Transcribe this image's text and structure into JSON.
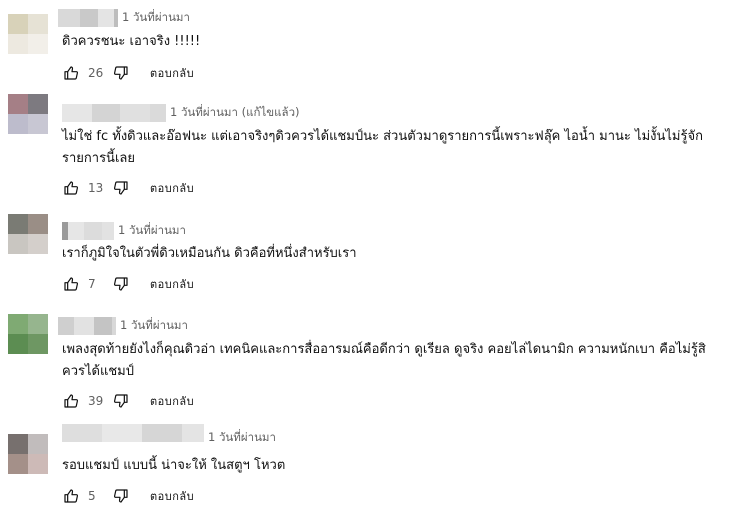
{
  "colors": {
    "text": "#0f0f0f",
    "meta": "#606060",
    "background": "#ffffff"
  },
  "comments": [
    {
      "time": "1 วันที่ผ่านมา",
      "text": "ดิวควรชนะ เอาจริง !!!!!",
      "likes": "26",
      "reply_label": "ตอบกลับ",
      "avatar_colors": [
        "#d8d2b9",
        "#e6e2d5",
        "#ede9e0",
        "#f2efe9"
      ],
      "name_blur_colors": [
        "#d9d9d9",
        "#c9c9c9",
        "#e4e4e4",
        "#bdbdbd"
      ]
    },
    {
      "time": "1 วันที่ผ่านมา (แก้ไขแล้ว)",
      "text": "ไม่ใช่ fc ทั้งดิวและอ๊อฟนะ แต่เอาจริงๆดิวควรได้แชมป์นะ  ส่วนตัวมาดูรายการนี้เพราะฟลุ๊ค ไอน้ำ มานะ ไม่งั้นไม่รู้จักรายการนี้เลย",
      "likes": "13",
      "reply_label": "ตอบกลับ",
      "avatar_colors": [
        "#a57f86",
        "#7d7a80",
        "#bdbccc",
        "#c8c7d3"
      ],
      "name_blur_colors": [
        "#e6e6e6",
        "#d4d4d4",
        "#e0e0e0",
        "#dadada"
      ]
    },
    {
      "time": "1 วันที่ผ่านมา",
      "text": "เราก็ภูมิใจในตัวพี่ดิวเหมือนกัน ดิวคือที่หนึ่งสำหรับเรา",
      "likes": "7",
      "reply_label": "ตอบกลับ",
      "avatar_colors": [
        "#7a7b74",
        "#9a8e86",
        "#c9c6c1",
        "#d4cfcb"
      ],
      "name_blur_colors": [
        "#9a9a9a",
        "#e6e6e6",
        "#dcdcdc",
        "#e2e2e2"
      ]
    },
    {
      "time": "1 วันที่ผ่านมา",
      "text": "เพลงสุดท้ายยังไงก็คุณดิวอ่า เทคนิคและการสื่ออารมณ์คือดีกว่า ดูเรียล ดูจริง คอยไล่ไดนามิก ความหนักเบา คือไม่รู้สิ ควรได้แชมป์",
      "likes": "39",
      "reply_label": "ตอบกลับ",
      "avatar_colors": [
        "#7faa73",
        "#96b58e",
        "#5c8d52",
        "#6e9763"
      ],
      "name_blur_colors": [
        "#cfcfcf",
        "#e2e2e2",
        "#c4c4c4",
        "#d8d8d8"
      ]
    },
    {
      "time": "1 วันที่ผ่านมา",
      "text": "รอบแชมป์ แบบนี้  น่าจะให้ ในสตูฯ โหวต",
      "likes": "5",
      "reply_label": "ตอบกลับ",
      "avatar_colors": [
        "#77706e",
        "#c1bcbc",
        "#a49089",
        "#cdbab7"
      ],
      "name_blur_colors": [
        "#dedede",
        "#e8e8e8",
        "#d6d6d6",
        "#e4e4e4"
      ]
    }
  ]
}
